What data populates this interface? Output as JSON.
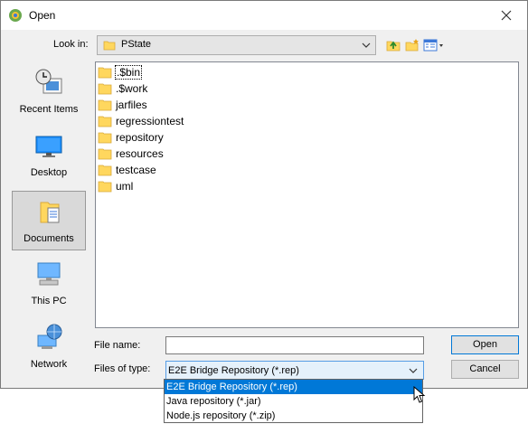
{
  "window": {
    "title": "Open",
    "close_icon": "close-icon",
    "app_icon": "app-icon"
  },
  "lookin": {
    "label": "Look in:",
    "value": "PState"
  },
  "toolbar": {
    "icons": [
      "up-folder-icon",
      "new-folder-icon",
      "view-menu-icon"
    ]
  },
  "places": [
    {
      "label": "Recent Items",
      "icon": "recent-items-icon"
    },
    {
      "label": "Desktop",
      "icon": "desktop-icon"
    },
    {
      "label": "Documents",
      "icon": "documents-icon",
      "selected": true
    },
    {
      "label": "This PC",
      "icon": "this-pc-icon"
    },
    {
      "label": "Network",
      "icon": "network-icon"
    }
  ],
  "files": [
    {
      "name": ".$bin"
    },
    {
      "name": ".$work"
    },
    {
      "name": "jarfiles"
    },
    {
      "name": "regressiontest"
    },
    {
      "name": "repository"
    },
    {
      "name": "resources"
    },
    {
      "name": "testcase"
    },
    {
      "name": "uml"
    }
  ],
  "filename": {
    "label": "File name:",
    "value": ""
  },
  "filetype": {
    "label": "Files of type:",
    "value": "E2E Bridge Repository (*.rep)",
    "options": [
      "E2E Bridge Repository (*.rep)",
      "Java repository (*.jar)",
      "Node.js repository (*.zip)"
    ]
  },
  "buttons": {
    "open": "Open",
    "cancel": "Cancel"
  },
  "colors": {
    "accent": "#0078d7",
    "folder": "#ffd75e"
  }
}
